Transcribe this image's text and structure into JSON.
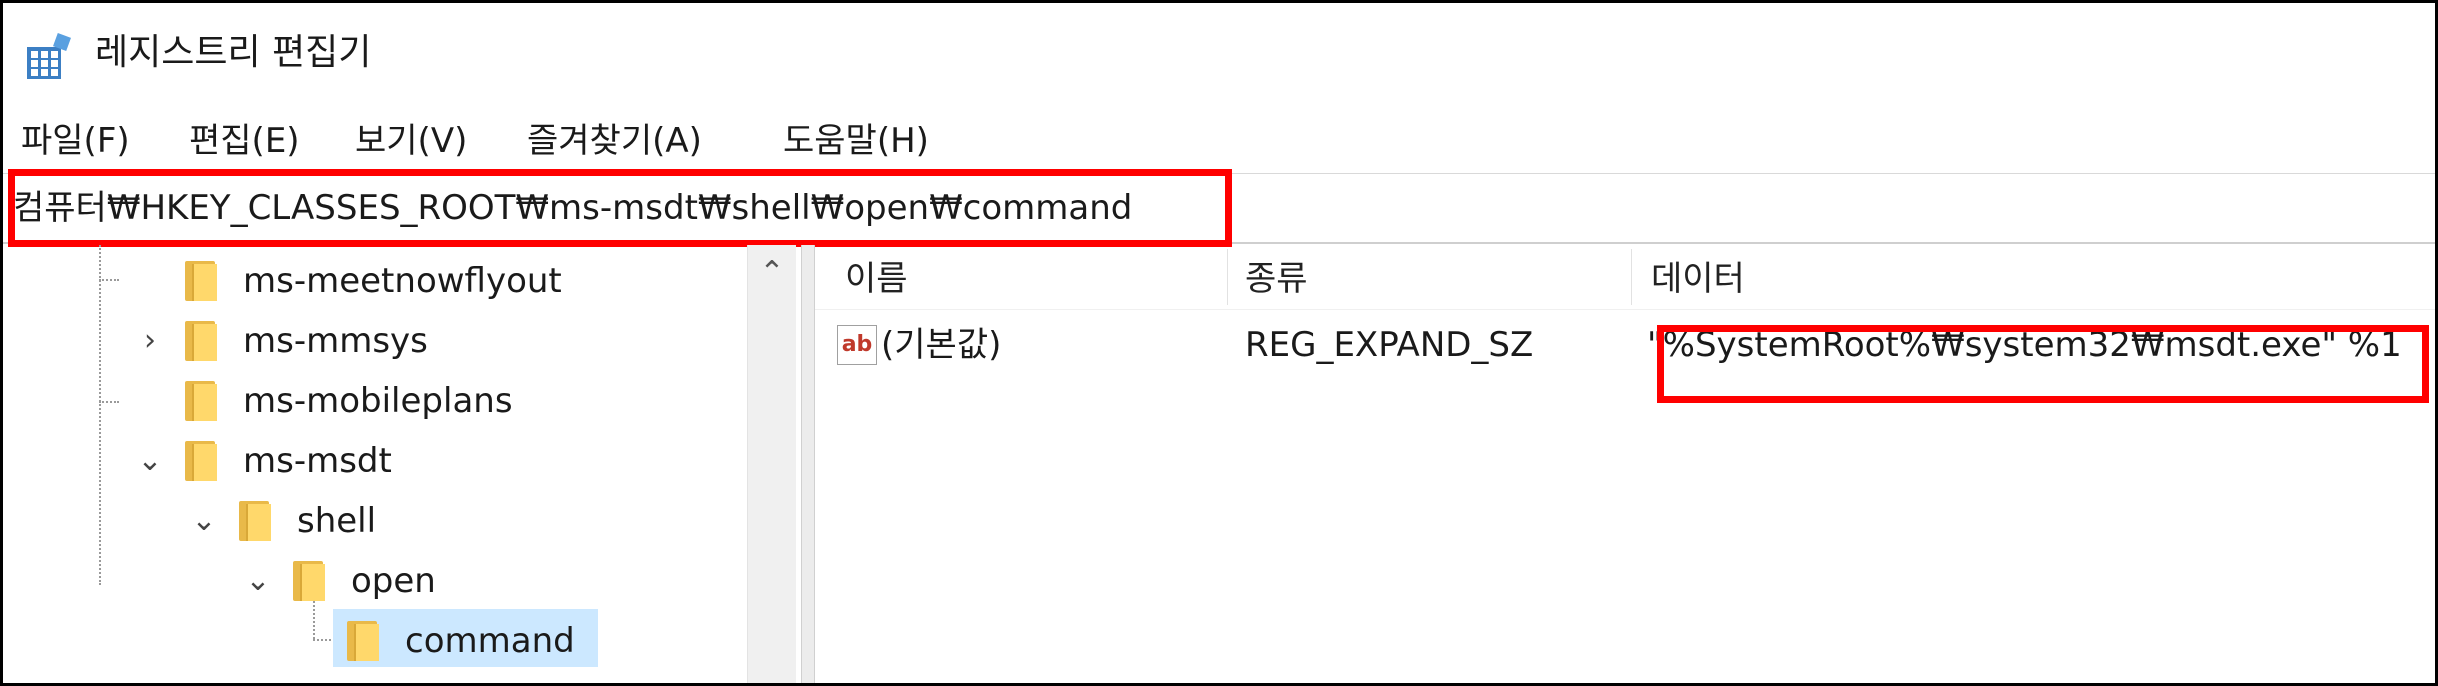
{
  "window": {
    "title": "레지스트리 편집기",
    "app_icon": "registry-editor-icon"
  },
  "menu": {
    "items": [
      "파일(F)",
      "편집(E)",
      "보기(V)",
      "즐겨찾기(A)",
      "도움말(H)"
    ]
  },
  "address": {
    "path": "컴퓨터₩HKEY_CLASSES_ROOT₩ms-msdt₩shell₩open₩command",
    "highlight_color": "#ff0000"
  },
  "tree": {
    "items": [
      {
        "label": "ms-meetnowflyout",
        "expander": "none",
        "icon": "folder-icon"
      },
      {
        "label": "ms-mmsys",
        "expander": "collapsed",
        "icon": "folder-icon"
      },
      {
        "label": "ms-mobileplans",
        "expander": "none",
        "icon": "folder-icon"
      },
      {
        "label": "ms-msdt",
        "expander": "expanded",
        "icon": "folder-icon"
      },
      {
        "label": "shell",
        "expander": "expanded",
        "icon": "folder-icon"
      },
      {
        "label": "open",
        "expander": "expanded",
        "icon": "folder-icon"
      },
      {
        "label": "command",
        "expander": "none",
        "icon": "folder-icon",
        "selected": true
      }
    ],
    "selected_color": "#cce8ff",
    "folder_color": "#ffd86b"
  },
  "list": {
    "columns": [
      "이름",
      "종류",
      "데이터"
    ],
    "rows": [
      {
        "icon": "string-value-icon",
        "icon_text": "ab",
        "name": "(기본값)",
        "type": "REG_EXPAND_SZ",
        "data": "\"%SystemRoot%₩system32₩msdt.exe\" %1"
      }
    ]
  }
}
